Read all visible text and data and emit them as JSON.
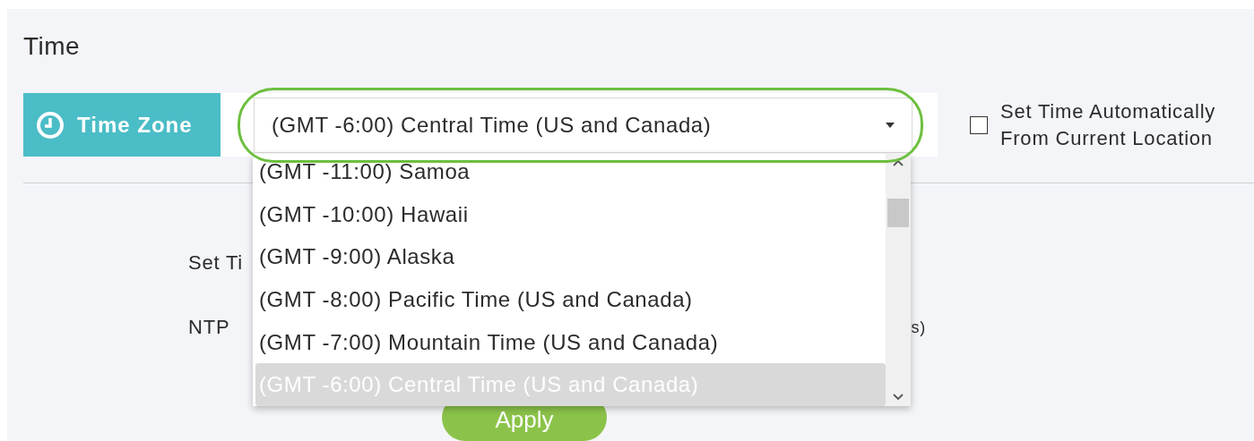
{
  "section": {
    "title": "Time"
  },
  "time_zone": {
    "label": "Time Zone",
    "value": "(GMT -6:00) Central Time (US and Canada)",
    "expanded": true,
    "options": [
      {
        "label": "(GMT -11:00) Samoa",
        "selected": false
      },
      {
        "label": "(GMT -10:00) Hawaii",
        "selected": false
      },
      {
        "label": "(GMT -9:00) Alaska",
        "selected": false
      },
      {
        "label": "(GMT -8:00) Pacific Time (US and Canada)",
        "selected": false
      },
      {
        "label": "(GMT -7:00) Mountain Time (US and Canada)",
        "selected": false
      },
      {
        "label": "(GMT -6:00) Central Time (US and Canada)",
        "selected": true
      }
    ]
  },
  "auto_time": {
    "label_lines": [
      "Set Time Automatically",
      "From Current Location"
    ],
    "checked": false
  },
  "form_rows": [
    {
      "label": "Set Ti"
    },
    {
      "label": "NTP",
      "trailing": "s)"
    }
  ],
  "apply_button": "Apply"
}
